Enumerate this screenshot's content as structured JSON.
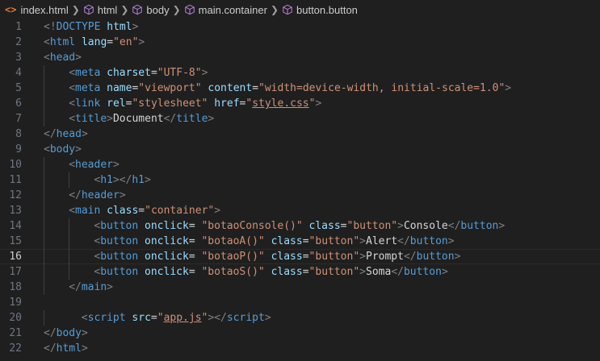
{
  "breadcrumb": {
    "file_icon": "<>",
    "file": "index.html",
    "html": "html",
    "body": "body",
    "main": "main.container",
    "button": "button.button"
  },
  "editor": {
    "active_line": 16,
    "lines": [
      {
        "n": "1",
        "indent": 0,
        "t": [
          [
            "punc",
            "<!"
          ],
          [
            "tag",
            "DOCTYPE"
          ],
          [
            "txt",
            " "
          ],
          [
            "attr",
            "html"
          ],
          [
            "punc",
            ">"
          ]
        ]
      },
      {
        "n": "2",
        "indent": 0,
        "t": [
          [
            "punc",
            "<"
          ],
          [
            "tag",
            "html"
          ],
          [
            "txt",
            " "
          ],
          [
            "attr",
            "lang"
          ],
          [
            "txt",
            "="
          ],
          [
            "str",
            "\"en\""
          ],
          [
            "punc",
            ">"
          ]
        ]
      },
      {
        "n": "3",
        "indent": 0,
        "t": [
          [
            "punc",
            "<"
          ],
          [
            "tag",
            "head"
          ],
          [
            "punc",
            ">"
          ]
        ]
      },
      {
        "n": "4",
        "indent": 1,
        "t": [
          [
            "punc",
            "<"
          ],
          [
            "tag",
            "meta"
          ],
          [
            "txt",
            " "
          ],
          [
            "attr",
            "charset"
          ],
          [
            "txt",
            "="
          ],
          [
            "str",
            "\"UTF-8\""
          ],
          [
            "punc",
            ">"
          ]
        ]
      },
      {
        "n": "5",
        "indent": 1,
        "t": [
          [
            "punc",
            "<"
          ],
          [
            "tag",
            "meta"
          ],
          [
            "txt",
            " "
          ],
          [
            "attr",
            "name"
          ],
          [
            "txt",
            "="
          ],
          [
            "str",
            "\"viewport\""
          ],
          [
            "txt",
            " "
          ],
          [
            "attr",
            "content"
          ],
          [
            "txt",
            "="
          ],
          [
            "str",
            "\"width=device-width, initial-scale=1.0\""
          ],
          [
            "punc",
            ">"
          ]
        ]
      },
      {
        "n": "6",
        "indent": 1,
        "t": [
          [
            "punc",
            "<"
          ],
          [
            "tag",
            "link"
          ],
          [
            "txt",
            " "
          ],
          [
            "attr",
            "rel"
          ],
          [
            "txt",
            "="
          ],
          [
            "str",
            "\"stylesheet\""
          ],
          [
            "txt",
            " "
          ],
          [
            "attr",
            "href"
          ],
          [
            "txt",
            "="
          ],
          [
            "str",
            "\""
          ],
          [
            "link",
            "style.css"
          ],
          [
            "str",
            "\""
          ],
          [
            "punc",
            ">"
          ]
        ]
      },
      {
        "n": "7",
        "indent": 1,
        "t": [
          [
            "punc",
            "<"
          ],
          [
            "tag",
            "title"
          ],
          [
            "punc",
            ">"
          ],
          [
            "txt",
            "Document"
          ],
          [
            "punc",
            "</"
          ],
          [
            "tag",
            "title"
          ],
          [
            "punc",
            ">"
          ]
        ]
      },
      {
        "n": "8",
        "indent": 0,
        "t": [
          [
            "punc",
            "</"
          ],
          [
            "tag",
            "head"
          ],
          [
            "punc",
            ">"
          ]
        ]
      },
      {
        "n": "9",
        "indent": 0,
        "t": [
          [
            "punc",
            "<"
          ],
          [
            "tag",
            "body"
          ],
          [
            "punc",
            ">"
          ]
        ]
      },
      {
        "n": "10",
        "indent": 1,
        "t": [
          [
            "punc",
            "<"
          ],
          [
            "tag",
            "header"
          ],
          [
            "punc",
            ">"
          ]
        ]
      },
      {
        "n": "11",
        "indent": 2,
        "t": [
          [
            "punc",
            "<"
          ],
          [
            "tag",
            "h1"
          ],
          [
            "punc",
            "></"
          ],
          [
            "tag",
            "h1"
          ],
          [
            "punc",
            ">"
          ]
        ]
      },
      {
        "n": "12",
        "indent": 1,
        "t": [
          [
            "punc",
            "</"
          ],
          [
            "tag",
            "header"
          ],
          [
            "punc",
            ">"
          ]
        ]
      },
      {
        "n": "13",
        "indent": 1,
        "t": [
          [
            "punc",
            "<"
          ],
          [
            "tag",
            "main"
          ],
          [
            "txt",
            " "
          ],
          [
            "attr",
            "class"
          ],
          [
            "txt",
            "="
          ],
          [
            "str",
            "\"container\""
          ],
          [
            "punc",
            ">"
          ]
        ]
      },
      {
        "n": "14",
        "indent": 2,
        "t": [
          [
            "punc",
            "<"
          ],
          [
            "tag",
            "button"
          ],
          [
            "txt",
            " "
          ],
          [
            "attr",
            "onclick"
          ],
          [
            "txt",
            "= "
          ],
          [
            "str",
            "\"botaoConsole()\""
          ],
          [
            "txt",
            " "
          ],
          [
            "attr",
            "class"
          ],
          [
            "txt",
            "="
          ],
          [
            "str",
            "\"button\""
          ],
          [
            "punc",
            ">"
          ],
          [
            "txt",
            "Console"
          ],
          [
            "punc",
            "</"
          ],
          [
            "tag",
            "button"
          ],
          [
            "punc",
            ">"
          ]
        ]
      },
      {
        "n": "15",
        "indent": 2,
        "t": [
          [
            "punc",
            "<"
          ],
          [
            "tag",
            "button"
          ],
          [
            "txt",
            " "
          ],
          [
            "attr",
            "onclick"
          ],
          [
            "txt",
            "= "
          ],
          [
            "str",
            "\"botaoA()\""
          ],
          [
            "txt",
            " "
          ],
          [
            "attr",
            "class"
          ],
          [
            "txt",
            "="
          ],
          [
            "str",
            "\"button\""
          ],
          [
            "punc",
            ">"
          ],
          [
            "txt",
            "Alert"
          ],
          [
            "punc",
            "</"
          ],
          [
            "tag",
            "button"
          ],
          [
            "punc",
            ">"
          ]
        ]
      },
      {
        "n": "16",
        "indent": 2,
        "t": [
          [
            "punc",
            "<"
          ],
          [
            "tag",
            "button"
          ],
          [
            "txt",
            " "
          ],
          [
            "attr",
            "onclick"
          ],
          [
            "txt",
            "= "
          ],
          [
            "str",
            "\"botaoP()\""
          ],
          [
            "txt",
            " "
          ],
          [
            "attr",
            "class"
          ],
          [
            "txt",
            "="
          ],
          [
            "str",
            "\"button\""
          ],
          [
            "punc",
            ">"
          ],
          [
            "txt",
            "Prompt"
          ],
          [
            "punc",
            "</"
          ],
          [
            "tag",
            "button"
          ],
          [
            "punc",
            ">"
          ]
        ]
      },
      {
        "n": "17",
        "indent": 2,
        "t": [
          [
            "punc",
            "<"
          ],
          [
            "tag",
            "button"
          ],
          [
            "txt",
            " "
          ],
          [
            "attr",
            "onclick"
          ],
          [
            "txt",
            "= "
          ],
          [
            "str",
            "\"botaoS()\""
          ],
          [
            "txt",
            " "
          ],
          [
            "attr",
            "class"
          ],
          [
            "txt",
            "="
          ],
          [
            "str",
            "\"button\""
          ],
          [
            "punc",
            ">"
          ],
          [
            "txt",
            "Soma"
          ],
          [
            "punc",
            "</"
          ],
          [
            "tag",
            "button"
          ],
          [
            "punc",
            ">"
          ]
        ]
      },
      {
        "n": "18",
        "indent": 1,
        "t": [
          [
            "punc",
            "</"
          ],
          [
            "tag",
            "main"
          ],
          [
            "punc",
            ">"
          ]
        ]
      },
      {
        "n": "19",
        "indent": 0,
        "t": []
      },
      {
        "n": "20",
        "indent": 1,
        "pre": "  ",
        "t": [
          [
            "punc",
            "<"
          ],
          [
            "tag",
            "script"
          ],
          [
            "txt",
            " "
          ],
          [
            "attr",
            "src"
          ],
          [
            "txt",
            "="
          ],
          [
            "str",
            "\""
          ],
          [
            "link",
            "app.js"
          ],
          [
            "str",
            "\""
          ],
          [
            "punc",
            "></"
          ],
          [
            "tag",
            "script"
          ],
          [
            "punc",
            ">"
          ]
        ]
      },
      {
        "n": "21",
        "indent": 0,
        "t": [
          [
            "punc",
            "</"
          ],
          [
            "tag",
            "body"
          ],
          [
            "punc",
            ">"
          ]
        ]
      },
      {
        "n": "22",
        "indent": 0,
        "t": [
          [
            "punc",
            "</"
          ],
          [
            "tag",
            "html"
          ],
          [
            "punc",
            ">"
          ]
        ]
      }
    ]
  }
}
